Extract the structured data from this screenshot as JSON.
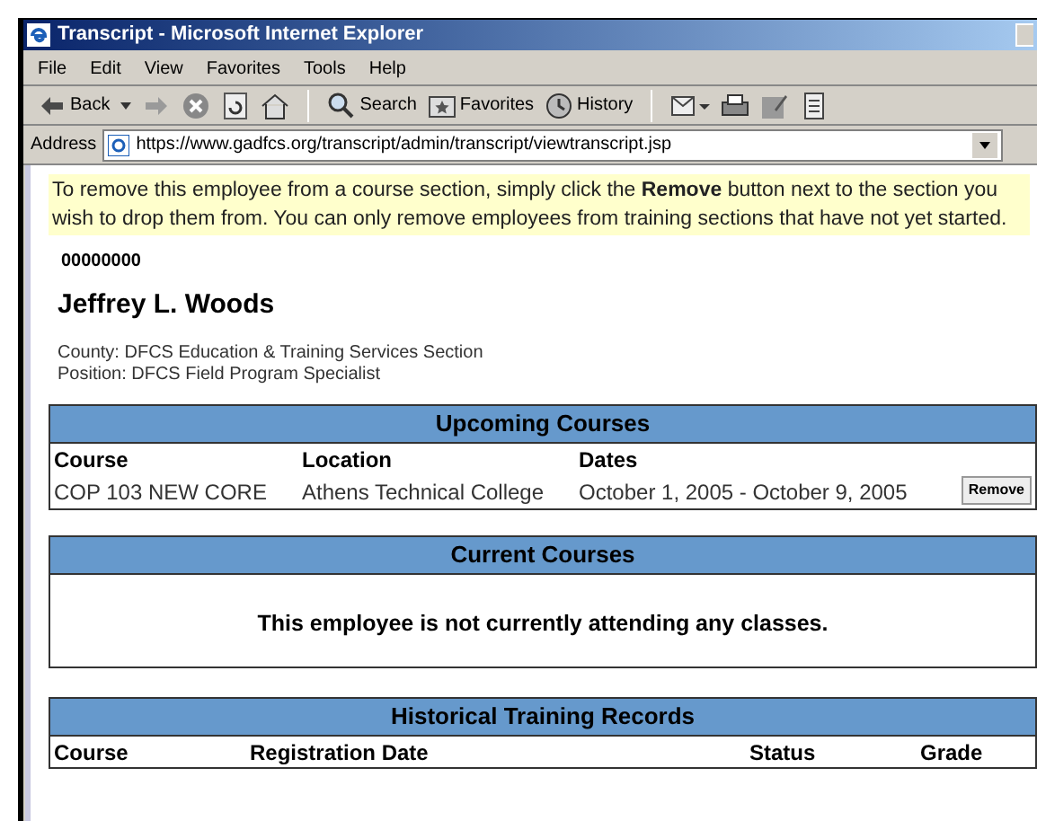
{
  "window": {
    "title": "Transcript - Microsoft Internet Explorer"
  },
  "menu": [
    "File",
    "Edit",
    "View",
    "Favorites",
    "Tools",
    "Help"
  ],
  "toolbar": [
    {
      "kind": "back",
      "label": "Back"
    },
    {
      "kind": "forward"
    },
    {
      "kind": "stop"
    },
    {
      "kind": "refresh"
    },
    {
      "kind": "home"
    },
    {
      "kind": "sep"
    },
    {
      "kind": "search",
      "label": "Search"
    },
    {
      "kind": "favorites",
      "label": "Favorites"
    },
    {
      "kind": "history",
      "label": "History"
    },
    {
      "kind": "sep"
    },
    {
      "kind": "mail"
    },
    {
      "kind": "print"
    },
    {
      "kind": "edit"
    },
    {
      "kind": "discuss"
    }
  ],
  "address": {
    "label": "Address",
    "url": "https://www.gadfcs.org/transcript/admin/transcript/viewtranscript.jsp"
  },
  "notice": "To remove this employee from a course section, simply click the **Remove** button next to the section you wish to drop them from. You can only remove employees from training sections that have not yet started.",
  "employee": {
    "id": "00000000",
    "name": "Jeffrey L. Woods",
    "county": "County: DFCS Education & Training Services Section",
    "position": "Position: DFCS Field Program Specialist"
  },
  "upcoming": {
    "title": "Upcoming Courses",
    "columns": [
      "Course",
      "Location",
      "Dates"
    ],
    "rows": [
      {
        "cells": [
          "COP 103 NEW CORE",
          "Athens Technical College",
          "October 1, 2005 - October 9, 2005"
        ],
        "action": "Remove"
      }
    ]
  },
  "current": {
    "title": "Current Courses",
    "message": "This employee is not currently attending any classes."
  },
  "historical": {
    "title": "Historical Training Records",
    "columns": [
      "Course",
      "Registration Date",
      "Status",
      "Grade"
    ]
  }
}
